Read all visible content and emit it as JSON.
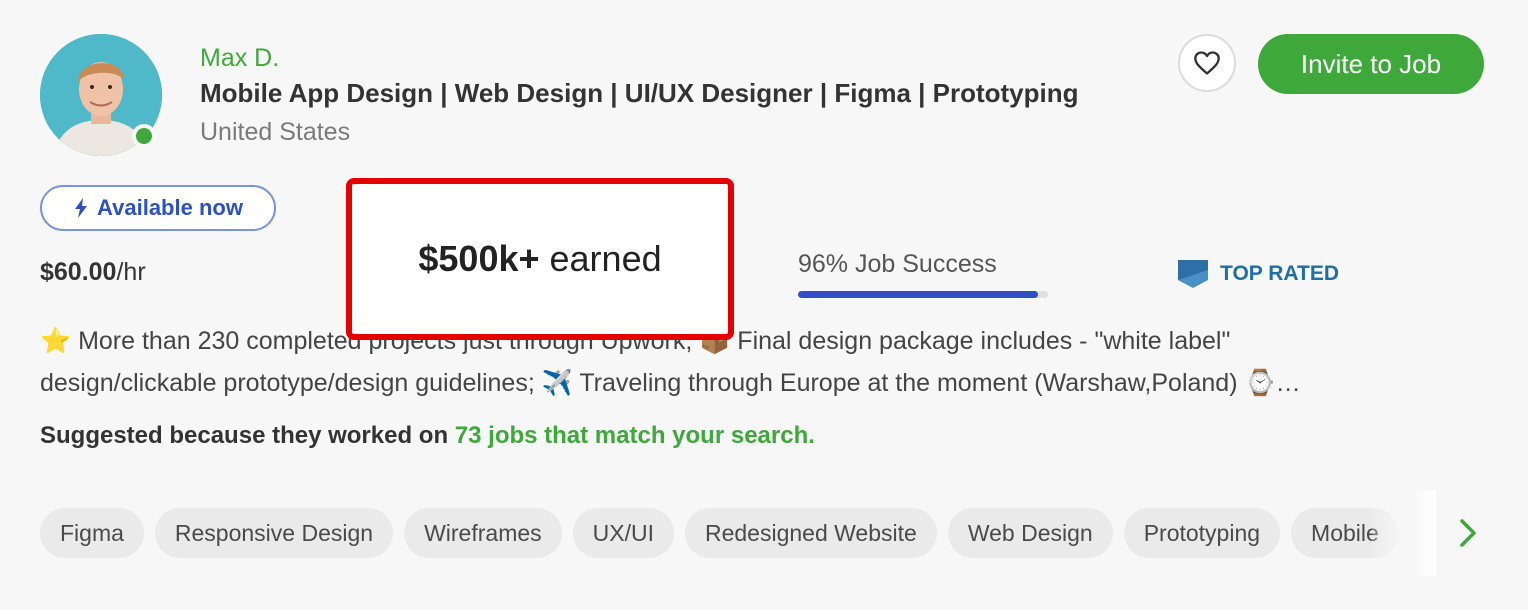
{
  "profile": {
    "name": "Max D.",
    "headline": "Mobile App Design | Web Design | UI/UX Designer | Figma | Prototyping",
    "location": "United States",
    "online": true
  },
  "actions": {
    "invite_label": "Invite to Job",
    "save_icon": "heart-icon"
  },
  "availability": {
    "label": "Available now",
    "icon": "lightning-icon"
  },
  "stats": {
    "rate_value": "$60.00",
    "rate_unit": "/hr",
    "earned_value": "$500k+",
    "earned_suffix": "earned",
    "job_success_label": "96% Job Success",
    "job_success_percent": 96,
    "badge_label": "TOP RATED"
  },
  "description": {
    "line1": "⭐ More than 230 completed projects just through Upwork; 📦 Final design package includes - \"white label\"",
    "line2": "design/clickable prototype/design guidelines; ✈️ Traveling through Europe at the moment (Warshaw,Poland) ⌚…"
  },
  "suggestion": {
    "prefix": "Suggested because they worked on ",
    "link": "73 jobs that match your search."
  },
  "skills": [
    "Figma",
    "Responsive Design",
    "Wireframes",
    "UX/UI",
    "Redesigned Website",
    "Web Design",
    "Prototyping",
    "Mobile"
  ],
  "colors": {
    "brand_green": "#3ea83a",
    "accent_blue": "#2d51c4",
    "highlight_red": "#e50000"
  }
}
